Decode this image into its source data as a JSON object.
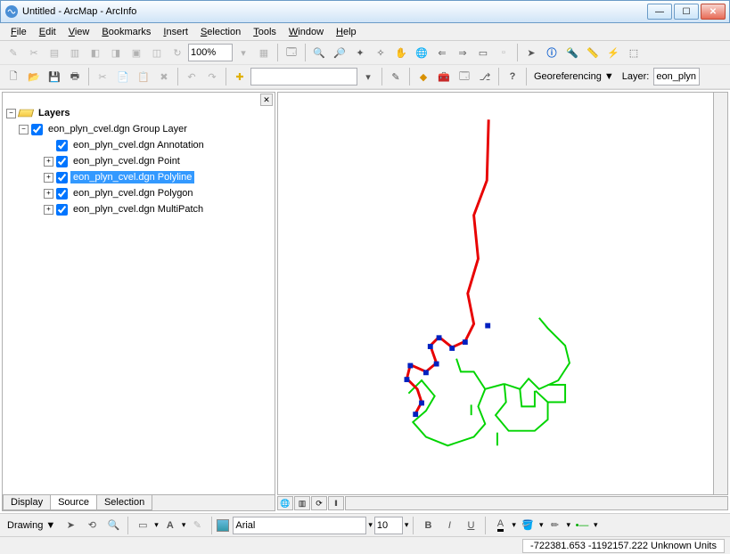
{
  "window": {
    "title": "Untitled - ArcMap - ArcInfo"
  },
  "menu": {
    "file": "File",
    "edit": "Edit",
    "view": "View",
    "bookmarks": "Bookmarks",
    "insert": "Insert",
    "selection": "Selection",
    "tools": "Tools",
    "window": "Window",
    "help": "Help"
  },
  "toolbar1": {
    "zoom": "100%"
  },
  "toolbar2": {
    "georef": "Georeferencing ▼",
    "layer_label": "Layer:",
    "layer_val": "eon_plyn"
  },
  "toc": {
    "root": "Layers",
    "group": "eon_plyn_cvel.dgn Group Layer",
    "items": [
      "eon_plyn_cvel.dgn Annotation",
      "eon_plyn_cvel.dgn Point",
      "eon_plyn_cvel.dgn Polyline",
      "eon_plyn_cvel.dgn Polygon",
      "eon_plyn_cvel.dgn MultiPatch"
    ],
    "tabs": {
      "display": "Display",
      "source": "Source",
      "selection": "Selection"
    }
  },
  "draw": {
    "label": "Drawing ▼",
    "font": "Arial",
    "size": "10"
  },
  "status": {
    "coords": "-722381.653 -1192157.222 Unknown Units"
  }
}
